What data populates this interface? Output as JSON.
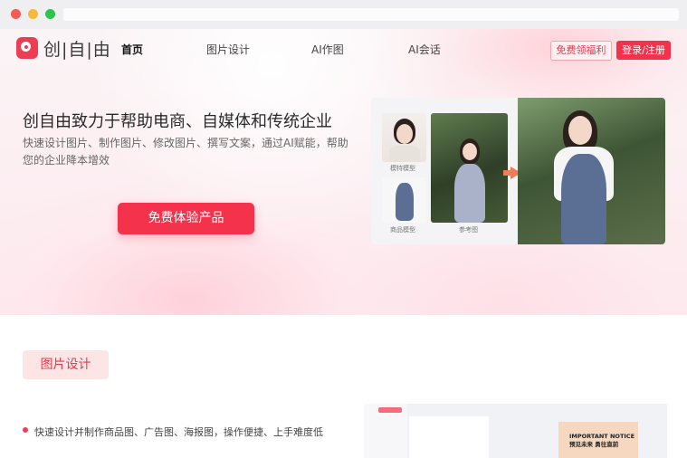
{
  "brand": {
    "name": "创|自|由"
  },
  "nav": {
    "items": [
      "首页",
      "图片设计",
      "AI作图",
      "AI会话"
    ],
    "active_index": 0,
    "welfare_label": "免费领福利",
    "login_label": "登录/注册"
  },
  "hero": {
    "title": "创自由致力于帮助电商、自媒体和传统企业",
    "description": "快速设计图片、制作图片、修改图片、撰写文案，通过AI赋能，帮助您的企业降本增效",
    "cta_label": "免费体验产品",
    "demo": {
      "model_caption": "模特模型",
      "product_caption": "商品模型",
      "reference_caption": "参考图"
    }
  },
  "section": {
    "tag": "图片设计",
    "bullet": "快速设计并制作商品图、广告图、海报图，操作便捷、上手难度低",
    "editor_notice_line1": "IMPORTANT NOTICE",
    "editor_notice_line2": "预见未来 勇往直前"
  },
  "colors": {
    "accent": "#f5324b",
    "tag_bg": "#fde5e6",
    "arrow": "#ef7c58"
  }
}
